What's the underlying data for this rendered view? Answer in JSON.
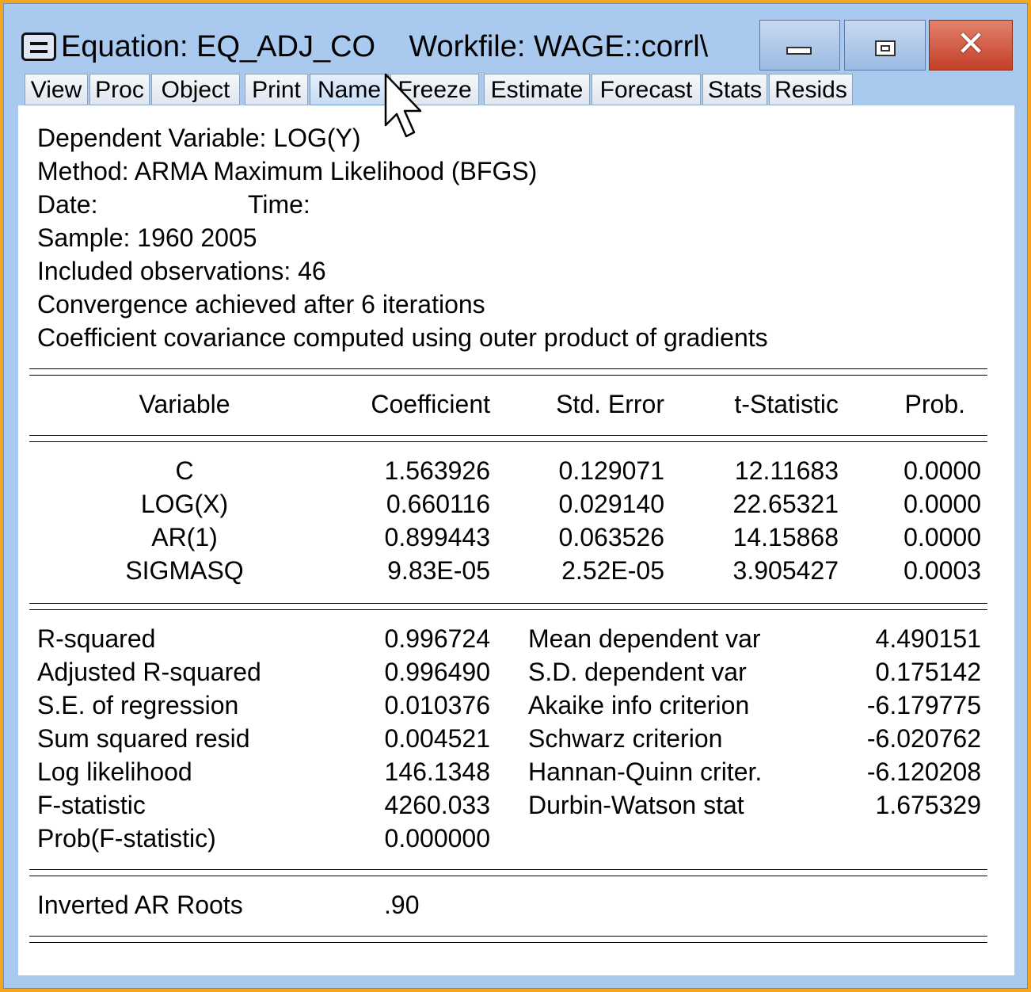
{
  "window": {
    "title": "Equation: EQ_ADJ_CO    Workfile: WAGE::corrl\\"
  },
  "toolbar": {
    "items": [
      "View",
      "Proc",
      "Object",
      "Print",
      "Name",
      "Freeze",
      "Estimate",
      "Forecast",
      "Stats",
      "Resids"
    ]
  },
  "header": {
    "dependent": "Dependent Variable: LOG(Y)",
    "method": "Method: ARMA Maximum Likelihood (BFGS)",
    "date_label": "Date:",
    "time_label": "Time:",
    "sample": "Sample: 1960 2005",
    "observations": "Included observations: 46",
    "convergence": "Convergence achieved after 6 iterations",
    "covariance": "Coefficient covariance computed using outer product of gradients"
  },
  "coef_table": {
    "columns": [
      "Variable",
      "Coefficient",
      "Std. Error",
      "t-Statistic",
      "Prob."
    ],
    "rows": [
      [
        "C",
        "1.563926",
        "0.129071",
        "12.11683",
        "0.0000"
      ],
      [
        "LOG(X)",
        "0.660116",
        "0.029140",
        "22.65321",
        "0.0000"
      ],
      [
        "AR(1)",
        "0.899443",
        "0.063526",
        "14.15868",
        "0.0000"
      ],
      [
        "SIGMASQ",
        "9.83E-05",
        "2.52E-05",
        "3.905427",
        "0.0003"
      ]
    ]
  },
  "stats": {
    "left": [
      [
        "R-squared",
        "0.996724"
      ],
      [
        "Adjusted R-squared",
        "0.996490"
      ],
      [
        "S.E. of regression",
        "0.010376"
      ],
      [
        "Sum squared resid",
        "0.004521"
      ],
      [
        "Log likelihood",
        "146.1348"
      ],
      [
        "F-statistic",
        "4260.033"
      ],
      [
        "Prob(F-statistic)",
        "0.000000"
      ]
    ],
    "right": [
      [
        "Mean dependent var",
        "4.490151"
      ],
      [
        "S.D. dependent var",
        "0.175142"
      ],
      [
        "Akaike info criterion",
        "-6.179775"
      ],
      [
        "Schwarz criterion",
        "-6.020762"
      ],
      [
        "Hannan-Quinn criter.",
        "-6.120208"
      ],
      [
        "Durbin-Watson stat",
        "1.675329"
      ]
    ]
  },
  "roots": {
    "label": "Inverted AR Roots",
    "value": ".90"
  }
}
